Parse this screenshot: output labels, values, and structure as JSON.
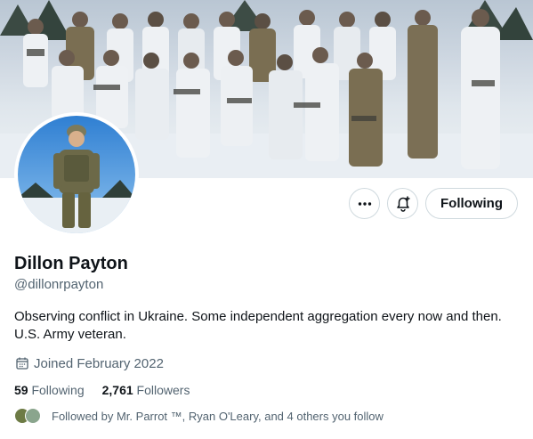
{
  "profile": {
    "name": "Dillon Payton",
    "handle": "@dillonrpayton",
    "bio": "Observing conflict in Ukraine. Some independent aggregation every now and then. U.S. Army veteran.",
    "joined": "Joined February 2022",
    "following_count": "59",
    "following_label": "Following",
    "followers_count": "2,761",
    "followers_label": "Followers",
    "followed_by": "Followed by Mr. Parrot ™, Ryan O'Leary, and 4 others you follow"
  },
  "actions": {
    "more_icon": "more-dots-icon",
    "notify_icon": "bell-plus-icon",
    "follow_label": "Following"
  },
  "icons": {
    "joined": "calendar-icon"
  },
  "colors": {
    "secondary_text": "#536471",
    "border": "#cfd9de"
  }
}
